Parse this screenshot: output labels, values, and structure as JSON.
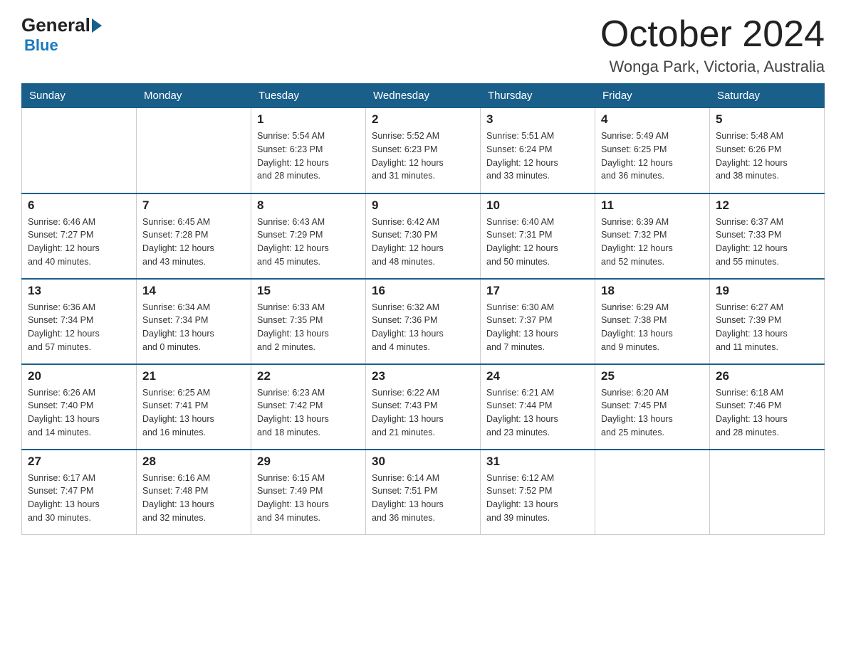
{
  "header": {
    "logo_general": "General",
    "logo_blue": "Blue",
    "month_title": "October 2024",
    "location": "Wonga Park, Victoria, Australia"
  },
  "days_of_week": [
    "Sunday",
    "Monday",
    "Tuesday",
    "Wednesday",
    "Thursday",
    "Friday",
    "Saturday"
  ],
  "weeks": [
    [
      {
        "day": "",
        "info": ""
      },
      {
        "day": "",
        "info": ""
      },
      {
        "day": "1",
        "info": "Sunrise: 5:54 AM\nSunset: 6:23 PM\nDaylight: 12 hours\nand 28 minutes."
      },
      {
        "day": "2",
        "info": "Sunrise: 5:52 AM\nSunset: 6:23 PM\nDaylight: 12 hours\nand 31 minutes."
      },
      {
        "day": "3",
        "info": "Sunrise: 5:51 AM\nSunset: 6:24 PM\nDaylight: 12 hours\nand 33 minutes."
      },
      {
        "day": "4",
        "info": "Sunrise: 5:49 AM\nSunset: 6:25 PM\nDaylight: 12 hours\nand 36 minutes."
      },
      {
        "day": "5",
        "info": "Sunrise: 5:48 AM\nSunset: 6:26 PM\nDaylight: 12 hours\nand 38 minutes."
      }
    ],
    [
      {
        "day": "6",
        "info": "Sunrise: 6:46 AM\nSunset: 7:27 PM\nDaylight: 12 hours\nand 40 minutes."
      },
      {
        "day": "7",
        "info": "Sunrise: 6:45 AM\nSunset: 7:28 PM\nDaylight: 12 hours\nand 43 minutes."
      },
      {
        "day": "8",
        "info": "Sunrise: 6:43 AM\nSunset: 7:29 PM\nDaylight: 12 hours\nand 45 minutes."
      },
      {
        "day": "9",
        "info": "Sunrise: 6:42 AM\nSunset: 7:30 PM\nDaylight: 12 hours\nand 48 minutes."
      },
      {
        "day": "10",
        "info": "Sunrise: 6:40 AM\nSunset: 7:31 PM\nDaylight: 12 hours\nand 50 minutes."
      },
      {
        "day": "11",
        "info": "Sunrise: 6:39 AM\nSunset: 7:32 PM\nDaylight: 12 hours\nand 52 minutes."
      },
      {
        "day": "12",
        "info": "Sunrise: 6:37 AM\nSunset: 7:33 PM\nDaylight: 12 hours\nand 55 minutes."
      }
    ],
    [
      {
        "day": "13",
        "info": "Sunrise: 6:36 AM\nSunset: 7:34 PM\nDaylight: 12 hours\nand 57 minutes."
      },
      {
        "day": "14",
        "info": "Sunrise: 6:34 AM\nSunset: 7:34 PM\nDaylight: 13 hours\nand 0 minutes."
      },
      {
        "day": "15",
        "info": "Sunrise: 6:33 AM\nSunset: 7:35 PM\nDaylight: 13 hours\nand 2 minutes."
      },
      {
        "day": "16",
        "info": "Sunrise: 6:32 AM\nSunset: 7:36 PM\nDaylight: 13 hours\nand 4 minutes."
      },
      {
        "day": "17",
        "info": "Sunrise: 6:30 AM\nSunset: 7:37 PM\nDaylight: 13 hours\nand 7 minutes."
      },
      {
        "day": "18",
        "info": "Sunrise: 6:29 AM\nSunset: 7:38 PM\nDaylight: 13 hours\nand 9 minutes."
      },
      {
        "day": "19",
        "info": "Sunrise: 6:27 AM\nSunset: 7:39 PM\nDaylight: 13 hours\nand 11 minutes."
      }
    ],
    [
      {
        "day": "20",
        "info": "Sunrise: 6:26 AM\nSunset: 7:40 PM\nDaylight: 13 hours\nand 14 minutes."
      },
      {
        "day": "21",
        "info": "Sunrise: 6:25 AM\nSunset: 7:41 PM\nDaylight: 13 hours\nand 16 minutes."
      },
      {
        "day": "22",
        "info": "Sunrise: 6:23 AM\nSunset: 7:42 PM\nDaylight: 13 hours\nand 18 minutes."
      },
      {
        "day": "23",
        "info": "Sunrise: 6:22 AM\nSunset: 7:43 PM\nDaylight: 13 hours\nand 21 minutes."
      },
      {
        "day": "24",
        "info": "Sunrise: 6:21 AM\nSunset: 7:44 PM\nDaylight: 13 hours\nand 23 minutes."
      },
      {
        "day": "25",
        "info": "Sunrise: 6:20 AM\nSunset: 7:45 PM\nDaylight: 13 hours\nand 25 minutes."
      },
      {
        "day": "26",
        "info": "Sunrise: 6:18 AM\nSunset: 7:46 PM\nDaylight: 13 hours\nand 28 minutes."
      }
    ],
    [
      {
        "day": "27",
        "info": "Sunrise: 6:17 AM\nSunset: 7:47 PM\nDaylight: 13 hours\nand 30 minutes."
      },
      {
        "day": "28",
        "info": "Sunrise: 6:16 AM\nSunset: 7:48 PM\nDaylight: 13 hours\nand 32 minutes."
      },
      {
        "day": "29",
        "info": "Sunrise: 6:15 AM\nSunset: 7:49 PM\nDaylight: 13 hours\nand 34 minutes."
      },
      {
        "day": "30",
        "info": "Sunrise: 6:14 AM\nSunset: 7:51 PM\nDaylight: 13 hours\nand 36 minutes."
      },
      {
        "day": "31",
        "info": "Sunrise: 6:12 AM\nSunset: 7:52 PM\nDaylight: 13 hours\nand 39 minutes."
      },
      {
        "day": "",
        "info": ""
      },
      {
        "day": "",
        "info": ""
      }
    ]
  ]
}
